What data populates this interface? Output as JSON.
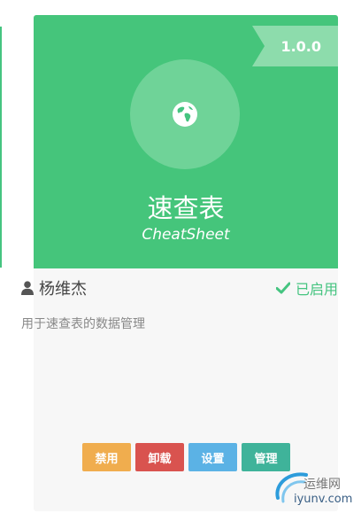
{
  "plugin": {
    "version": "1.0.0",
    "icon": "globe-icon",
    "name": "速查表",
    "name_en": "CheatSheet",
    "author": "杨维杰",
    "author_icon": "user-icon",
    "status": "已启用",
    "status_icon": "check-icon",
    "description": "用于速查表的数据管理"
  },
  "actions": {
    "disable": "禁用",
    "uninstall": "卸载",
    "settings": "设置",
    "manage": "管理"
  },
  "colors": {
    "card_header": "#45c57b",
    "ribbon": "#8ddcac",
    "disable": "#f0ad4e",
    "uninstall": "#d9534f",
    "settings": "#5bb2e5",
    "manage": "#3fb39a"
  },
  "watermark": {
    "cn": "运维网",
    "domain": "iyunv.com"
  }
}
